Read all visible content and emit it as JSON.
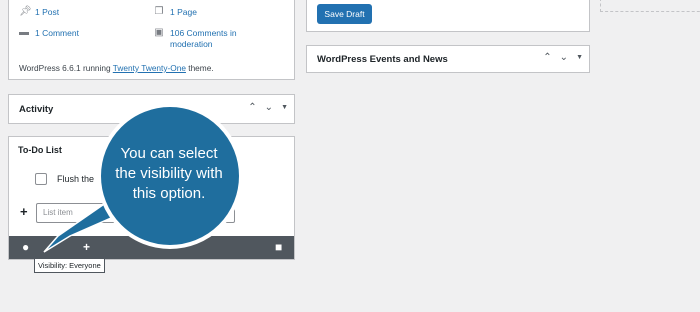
{
  "glance": {
    "post": "1 Post",
    "page": "1 Page",
    "comment": "1 Comment",
    "moderation_line1": "106 Comments in",
    "moderation_line2": "moderation",
    "wp_prefix": "WordPress 6.6.1 running ",
    "theme_link": "Twenty Twenty-One",
    "wp_suffix": " theme."
  },
  "activity": {
    "title": "Activity"
  },
  "todo": {
    "title": "To-Do List",
    "item": "Flush the",
    "input_placeholder": "List item",
    "tooltip": "Visibility: Everyone"
  },
  "quick_draft": {
    "save_label": "Save Draft"
  },
  "events": {
    "title": "WordPress Events and News"
  },
  "callout": {
    "line1": "You can select",
    "line2": "the visibility with",
    "line3": "this option."
  },
  "icons": {
    "pin": "pin-icon",
    "pages": "pages-icon",
    "comment": "comment-icon",
    "moderation": "comments-icon",
    "globe": "globe-icon",
    "plus": "plus-icon",
    "trash": "trash-icon"
  },
  "colors": {
    "accent": "#2271b1",
    "callout": "#1f6e9e",
    "toolbar": "#50575e"
  }
}
